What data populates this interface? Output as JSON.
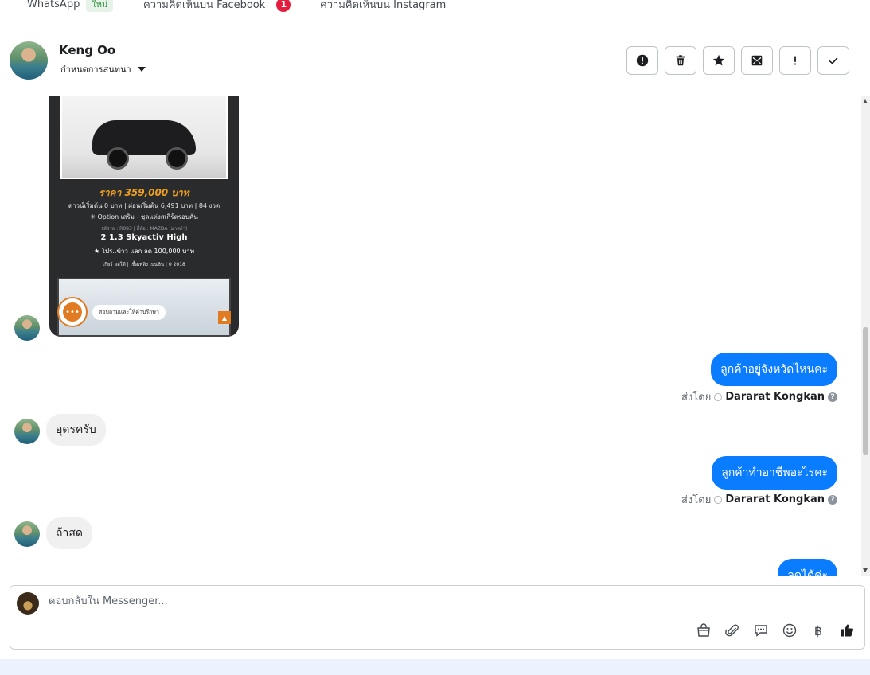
{
  "tabs": [
    {
      "label": "WhatsApp",
      "badge": "ใหม่"
    },
    {
      "label": "ความคิดเห็นบน Facebook",
      "count": "1"
    },
    {
      "label": "ความคิดเห็นบน Instagram"
    }
  ],
  "header": {
    "contact_name": "Keng Oo",
    "assign_label": "กำหนดการสนทนา"
  },
  "actions": [
    {
      "name": "report-spam-button",
      "icon": "alert-circle-icon"
    },
    {
      "name": "delete-button",
      "icon": "trash-icon"
    },
    {
      "name": "star-button",
      "icon": "star-icon"
    },
    {
      "name": "mark-unread-button",
      "icon": "envelope-icon"
    },
    {
      "name": "follow-up-button",
      "icon": "exclamation-icon"
    },
    {
      "name": "mark-done-button",
      "icon": "check-icon"
    }
  ],
  "attachment": {
    "price": "ราคา 359,000 บาท",
    "down_payment": "ดาวน์เริ่มต้น 0 บาท | ผ่อนเริ่มต้น 6,491 บาท | 84 งวด",
    "option": "✳ Option เสริม - ชุดแต่งสเกิร์ตรอบคัน",
    "stock_info": "รหัสรถ : R083 | ยี่ห้อ : MAZDA (มาสด้า)",
    "model": "2 1.3 Skyactiv High",
    "promo": "★ โปร..ข้าว แลก ลด 100,000 บาท",
    "specs": "เกียร์ ออโต้ | เชื้อเพลิง เบนซิน | 0 2018",
    "consult_label": "สอบถามและให้คำปรึกษา"
  },
  "messages": [
    {
      "direction": "out",
      "text": "ลูกค้าอยู่จังหวัดไหนคะ",
      "sent_by_label": "ส่งโดย",
      "sender": "Dararat Kongkan"
    },
    {
      "direction": "in",
      "text": "อุดรครับ"
    },
    {
      "direction": "out",
      "text": "ลูกค้าทำอาชีพอะไรคะ",
      "sent_by_label": "ส่งโดย",
      "sender": "Dararat Kongkan"
    },
    {
      "direction": "in",
      "text": "ถ้าสด"
    },
    {
      "direction": "out",
      "text": "ลดได้ค่ะ"
    }
  ],
  "composer": {
    "placeholder": "ตอบกลับใน Messenger...",
    "tools": [
      "shopping-bag-icon",
      "paperclip-icon",
      "saved-reply-icon",
      "emoji-icon",
      "baht-icon",
      "thumbs-up-icon"
    ],
    "baht_symbol": "฿"
  }
}
